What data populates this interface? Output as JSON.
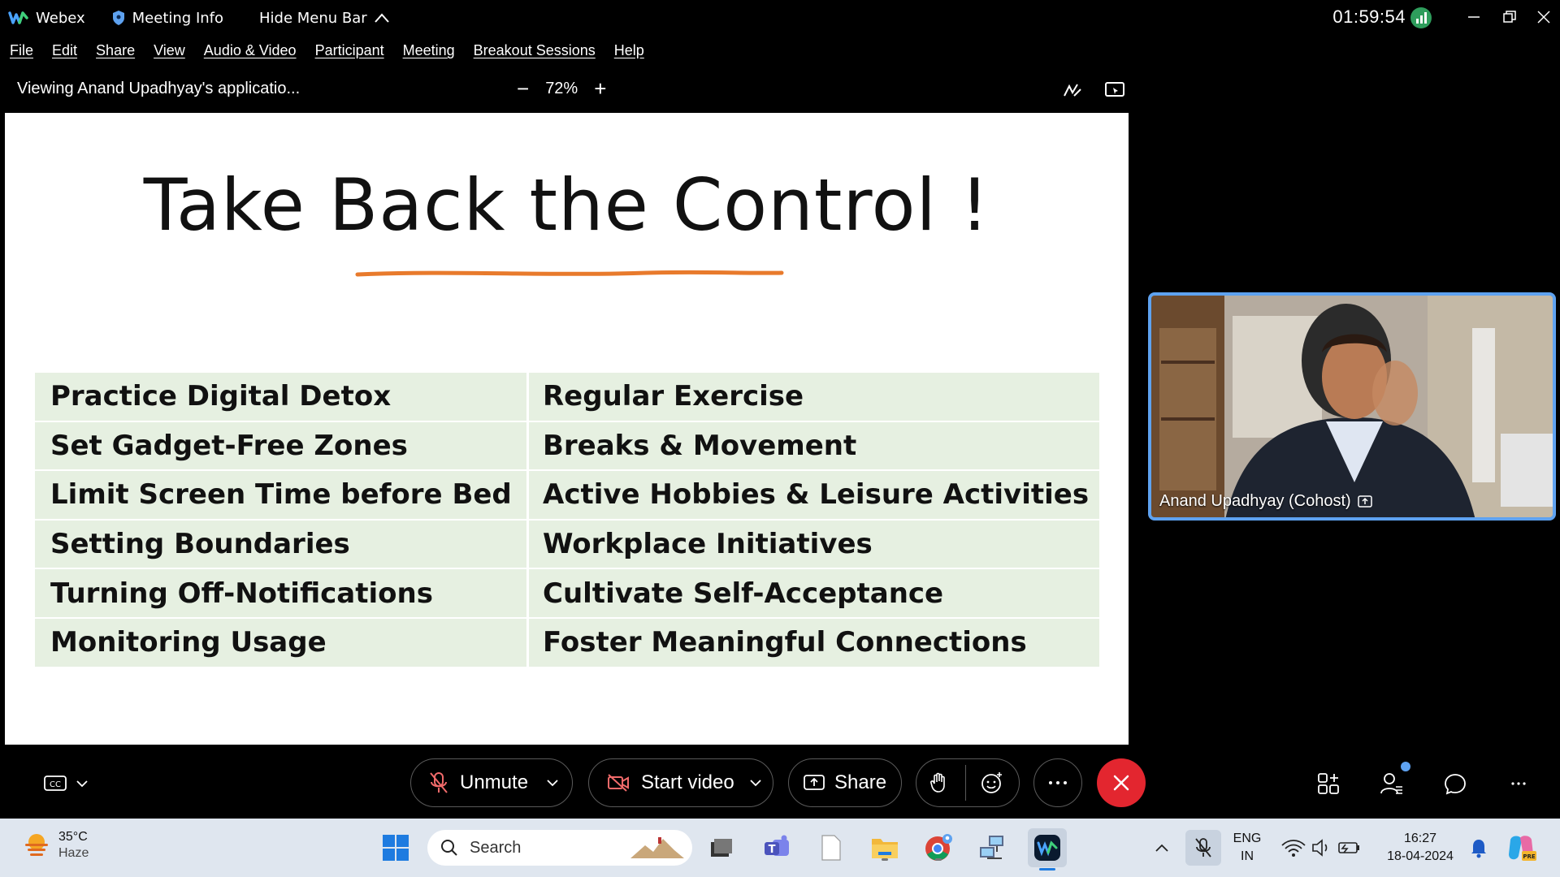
{
  "titlebar": {
    "app_name": "Webex",
    "meeting_info": "Meeting Info",
    "hide_menu": "Hide Menu Bar",
    "clock": "01:59:54"
  },
  "menu": [
    "File",
    "Edit",
    "Share",
    "View",
    "Audio & Video",
    "Participant",
    "Meeting",
    "Breakout Sessions",
    "Help"
  ],
  "sharebar": {
    "viewing": "Viewing Anand Upadhyay's applicatio...",
    "zoom": "72%"
  },
  "slide": {
    "title": "Take Back the Control !",
    "rows": [
      {
        "left": "Practice Digital Detox",
        "right": "Regular Exercise"
      },
      {
        "left": "Set Gadget-Free Zones",
        "right": "Breaks & Movement"
      },
      {
        "left": "Limit Screen Time before Bed",
        "right": "Active Hobbies & Leisure Activities"
      },
      {
        "left": "Setting Boundaries",
        "right": "Workplace Initiatives"
      },
      {
        "left": "Turning Off-Notifications",
        "right": "Cultivate Self-Acceptance"
      },
      {
        "left": "Monitoring Usage",
        "right": "Foster Meaningful Connections"
      }
    ],
    "accent_color": "#e87a2c"
  },
  "video": {
    "participant": "Anand Upadhyay (Cohost)",
    "border_color": "#5ea2f0"
  },
  "controls": {
    "unmute": "Unmute",
    "start_video": "Start video",
    "share": "Share",
    "end_color": "#e3262f"
  },
  "taskbar": {
    "temp": "35°C",
    "weather": "Haze",
    "search_placeholder": "Search",
    "lang1": "ENG",
    "lang2": "IN",
    "time": "16:27",
    "date": "18-04-2024"
  }
}
